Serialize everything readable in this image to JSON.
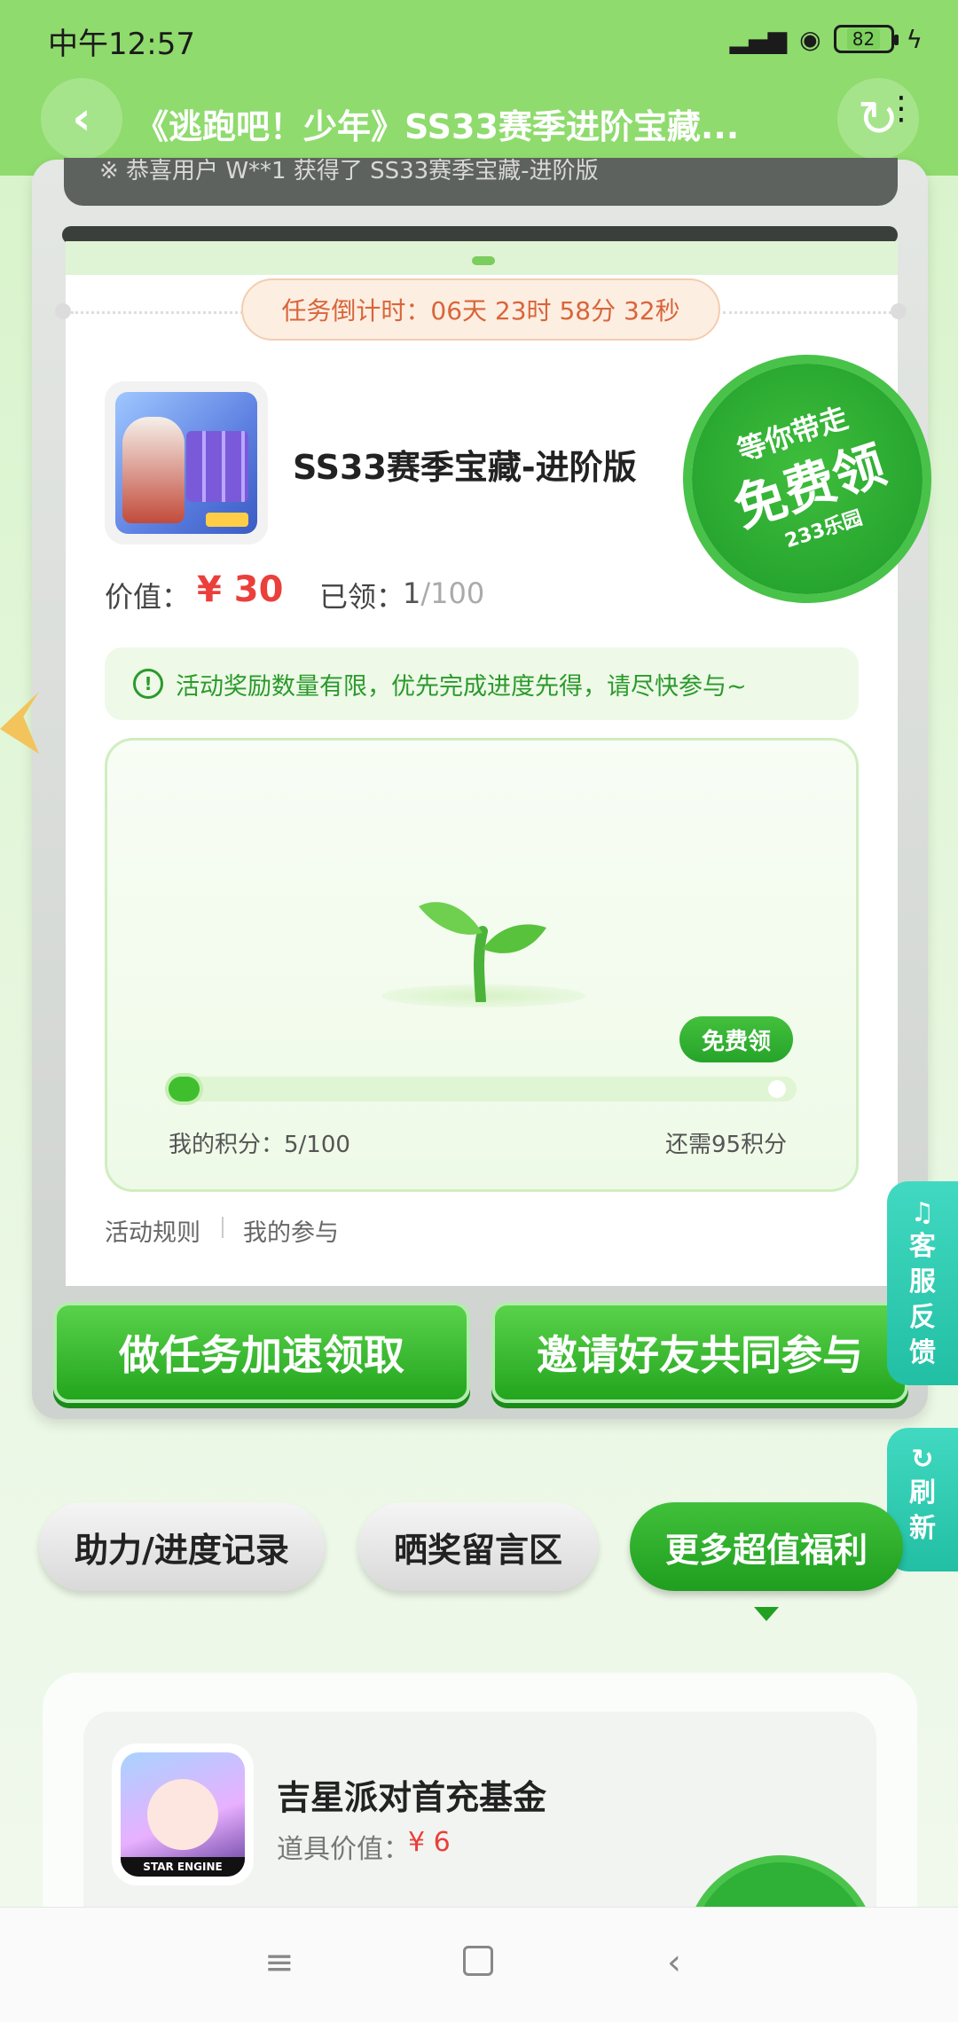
{
  "status": {
    "time": "中午12:57",
    "battery": "82"
  },
  "header": {
    "title": "《逃跑吧！少年》SS33赛季进阶宝藏...",
    "back_icon": "chevron-left-icon",
    "refresh_icon": "refresh-icon"
  },
  "search_strip": {
    "text": "※ 恭喜用户 W**1 获得了 SS33赛季宝藏-进阶版"
  },
  "countdown": {
    "text": "任务倒计时：06天 23时 58分 32秒"
  },
  "prize": {
    "name": "SS33赛季宝藏-进阶版",
    "value_label": "价值：",
    "value": "¥ 30",
    "claimed_label": "已领：",
    "claimed": "1",
    "claimed_total": "/100"
  },
  "seal": {
    "top": "等你带走",
    "mid": "免费领",
    "bottom": "233乐园"
  },
  "notice": {
    "icon": "!",
    "text": "活动奖励数量有限，优先完成进度先得，请尽快参与~"
  },
  "progress": {
    "free_label": "免费领",
    "my_score": "我的积分：5/100",
    "need": "还需95积分",
    "score": 5,
    "target": 100
  },
  "links": {
    "rules": "活动规则",
    "my_participation": "我的参与"
  },
  "actions": {
    "task": "做任务加速领取",
    "invite": "邀请好友共同参与"
  },
  "side": {
    "service": [
      "客",
      "服",
      "反",
      "馈"
    ],
    "service_icon": "headset-icon",
    "refresh": [
      "刷",
      "新"
    ],
    "refresh_icon": "refresh-icon"
  },
  "tabs": {
    "record": "助力/进度记录",
    "comments": "晒奖留言区",
    "more": "更多超值福利"
  },
  "welfare": {
    "name": "吉星派对首充基金",
    "value_label": "道具价值：",
    "value": "¥ 6",
    "thumb_banner": "STAR ENGINE"
  },
  "colors": {
    "brand_green": "#2fb036",
    "header_green": "#8fdb6e",
    "price_red": "#ea3f3a",
    "side_teal": "#22bfa4"
  }
}
